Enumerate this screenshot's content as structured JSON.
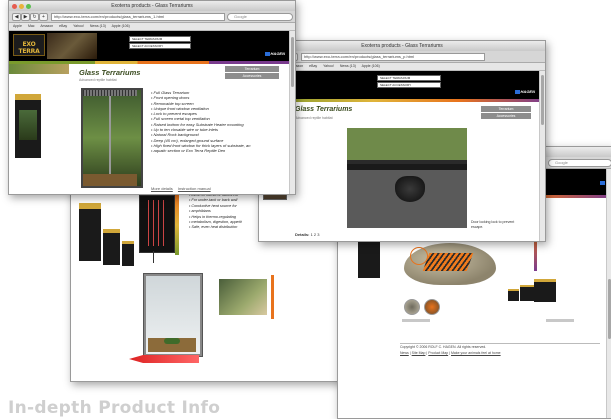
{
  "window1": {
    "title": "Exoterra products - Glass Terrariums",
    "url": "http://www.exo-terra.com/en/products/glass_terrariums_1.html",
    "search_placeholder": "Google",
    "bookmarks": [
      "Apple",
      "Mac",
      "Amazon",
      "eBay",
      "Yahoo!",
      "News (13)",
      "Apple (106)"
    ],
    "selects": [
      "SELECT TERRARIUM",
      "SELECT ACCESSORY"
    ],
    "hagen": "HAGEN",
    "page_title": "Glass Terrariums",
    "page_subtitle": "Advanced reptile habitat",
    "side_buttons": [
      "Terrarium",
      "Accessories"
    ],
    "features": [
      "Full Glass Terrarium",
      "Front opening doors",
      "Removable top screen",
      "Unique front window ventilation",
      "Lock to prevent escapes",
      "Full screen metal top ventilation",
      "Raised bottom for easy Substrate Heater mounting",
      "Up to ten closable wire or tube inlets",
      "Natural Rock background",
      "Deep (45 cm), enlarged ground surface",
      "High fixed front window for thick layers of substrate, an",
      "aquatic section or Exo Terra Reptile Den"
    ],
    "links": [
      "More details",
      "Instruction manual"
    ]
  },
  "window2": {
    "title": "Exoterra products - Glass Terrariums",
    "url": "http://www.exo-terra.com/en/products/glass_terrariums_p.html",
    "page_title": "Glass Terrariums",
    "page_subtitle": "Advanced reptile habitat",
    "caption": "Door locking lock to prevent escape.",
    "details_label": "Details:",
    "pages": "1 2 3"
  },
  "window3": {
    "features": [
      "Ideal for humid or rainforest",
      "For under-tank or back wall",
      "Conductive heat source for",
      "amphibians",
      "Helps in thermo-regulating",
      "metabolism, digestion, appetit",
      "Safe, even heat distribution"
    ]
  },
  "window4": {
    "search_placeholder": "Google",
    "copyright": "Copyright © 2006 ROLF C. HAGEN. All rights reserved.",
    "footer_links": [
      "News",
      "Site Map",
      "Product Map",
      "Make your animals feel at home"
    ]
  },
  "heading": "In-depth Product Info",
  "colors": {
    "exo_gold": "#e0b43a",
    "stripe_orange": "#e8731d",
    "stripe_green": "#7a9b2c",
    "stripe_purple": "#7a3b8e"
  }
}
